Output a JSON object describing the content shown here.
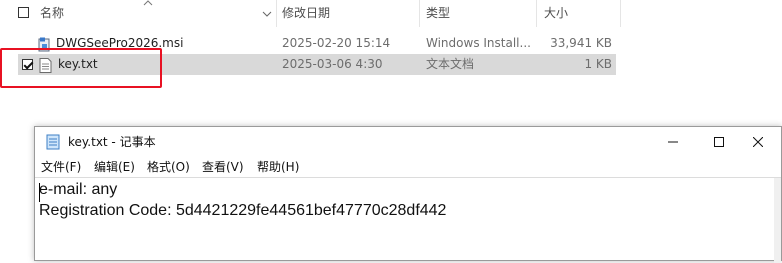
{
  "explorer": {
    "columns": {
      "name": "名称",
      "modified": "修改日期",
      "type": "类型",
      "size": "大小"
    },
    "files": [
      {
        "name": "DWGSeePro2026.msi",
        "modified": "2025-02-20 15:14",
        "type": "Windows Install...",
        "size": "33,941 KB",
        "selected": false,
        "icon": "msi-installer-icon"
      },
      {
        "name": "key.txt",
        "modified": "2025-03-06 4:30",
        "type": "文本文档",
        "size": "1 KB",
        "selected": true,
        "icon": "text-file-icon"
      }
    ],
    "highlight_color": "#e81123"
  },
  "notepad": {
    "title": "key.txt - 记事本",
    "menu": {
      "file": "文件(F)",
      "edit": "编辑(E)",
      "format": "格式(O)",
      "view": "查看(V)",
      "help": "帮助(H)"
    },
    "content": {
      "line1": "e-mail: any",
      "line2": "Registration Code: 5d4421229fe44561bef47770c28df442"
    }
  }
}
